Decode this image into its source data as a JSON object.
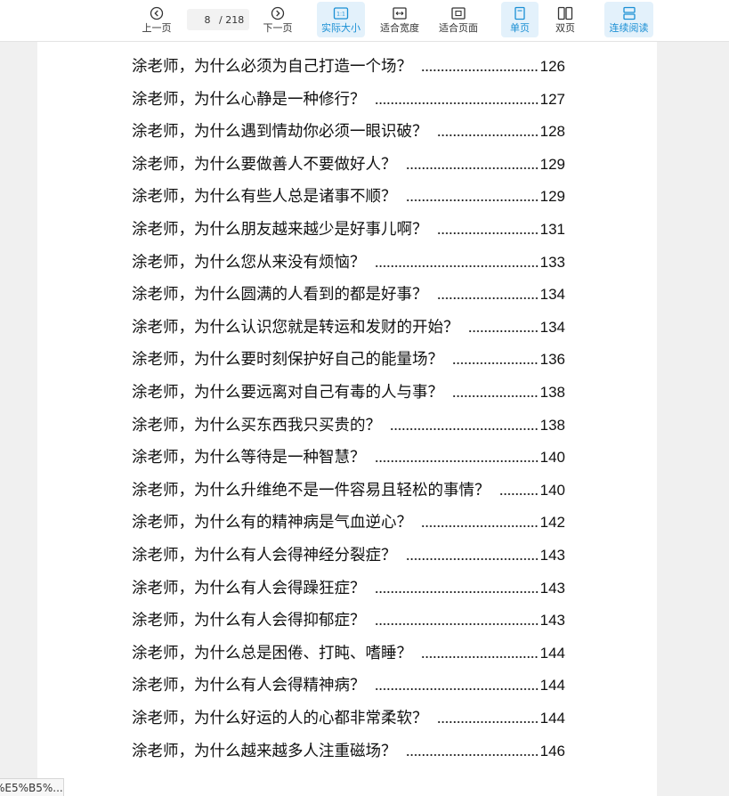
{
  "toolbar": {
    "prev_label": "上一页",
    "next_label": "下一页",
    "page_current": "8",
    "page_total": "/ 218",
    "actual_size_label": "实际大小",
    "fit_width_label": "适合宽度",
    "fit_page_label": "适合页面",
    "single_page_label": "单页",
    "double_page_label": "双页",
    "continuous_label": "连续阅读",
    "accent_color": "#1a8fd4"
  },
  "toc": {
    "entries": [
      {
        "title": "涂老师，为什么必须为自己打造一个场？",
        "page": "126"
      },
      {
        "title": "涂老师，为什么心静是一种修行？",
        "page": "127"
      },
      {
        "title": "涂老师，为什么遇到情劫你必须一眼识破？",
        "page": "128"
      },
      {
        "title": "涂老师，为什么要做善人不要做好人？",
        "page": "129"
      },
      {
        "title": "涂老师，为什么有些人总是诸事不顺？",
        "page": "129"
      },
      {
        "title": "涂老师，为什么朋友越来越少是好事儿啊？",
        "page": "131"
      },
      {
        "title": "涂老师，为什么您从来没有烦恼？",
        "page": "133"
      },
      {
        "title": "涂老师，为什么圆满的人看到的都是好事？",
        "page": "134"
      },
      {
        "title": "涂老师，为什么认识您就是转运和发财的开始？",
        "page": "134"
      },
      {
        "title": "涂老师，为什么要时刻保护好自己的能量场？",
        "page": "136"
      },
      {
        "title": "涂老师，为什么要远离对自己有毒的人与事？",
        "page": "138"
      },
      {
        "title": "涂老师，为什么买东西我只买贵的？",
        "page": "138"
      },
      {
        "title": "涂老师，为什么等待是一种智慧？",
        "page": "140"
      },
      {
        "title": "涂老师，为什么升维绝不是一件容易且轻松的事情？",
        "page": "140"
      },
      {
        "title": "涂老师，为什么有的精神病是气血逆心？",
        "page": "142"
      },
      {
        "title": "涂老师，为什么有人会得神经分裂症？",
        "page": "143"
      },
      {
        "title": "涂老师，为什么有人会得躁狂症？",
        "page": "143"
      },
      {
        "title": "涂老师，为什么有人会得抑郁症？",
        "page": "143"
      },
      {
        "title": "涂老师，为什么总是困倦、打盹、嗜睡？",
        "page": "144"
      },
      {
        "title": "涂老师，为什么有人会得精神病？",
        "page": "144"
      },
      {
        "title": "涂老师，为什么好运的人的心都非常柔软？",
        "page": "144"
      },
      {
        "title": "涂老师，为什么越来越多人注重磁场？",
        "page": "146"
      }
    ]
  },
  "status": {
    "text": "%E5%B5%..."
  }
}
